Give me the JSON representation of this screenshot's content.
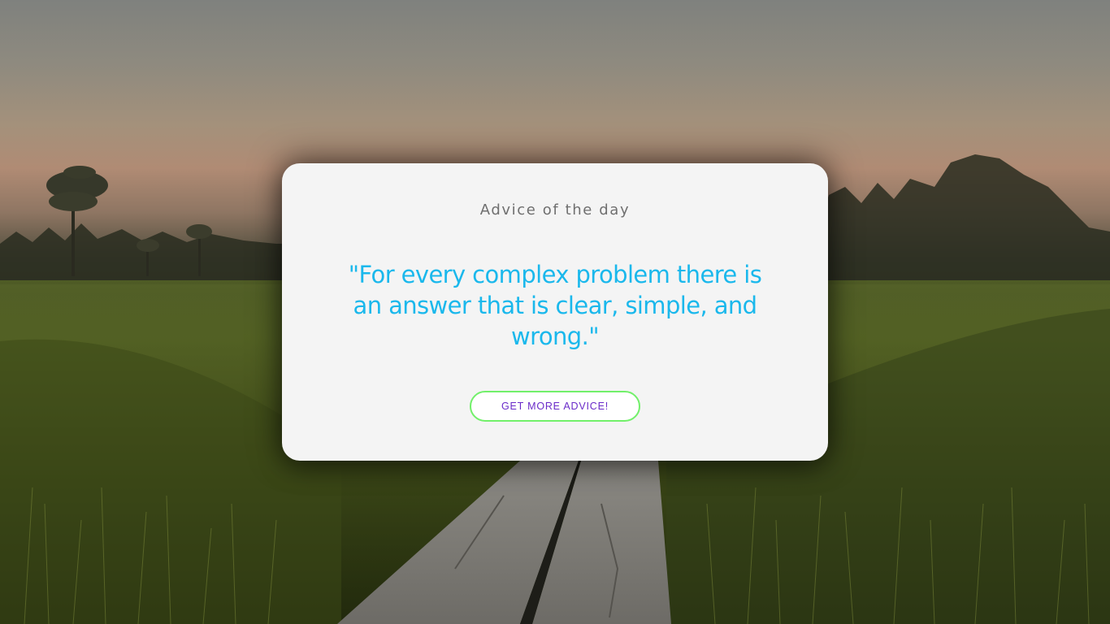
{
  "card": {
    "title": "Advice of the day",
    "quote": "\"For every complex problem there is an answer that is clear, simple, and wrong.\"",
    "button_label": "GET MORE ADVICE!"
  },
  "colors": {
    "card_background": "#f4f4f4",
    "title": "#6f6f6f",
    "quote": "#1ab8ec",
    "button_border": "#72f06a",
    "button_text": "#6a2bc9"
  }
}
